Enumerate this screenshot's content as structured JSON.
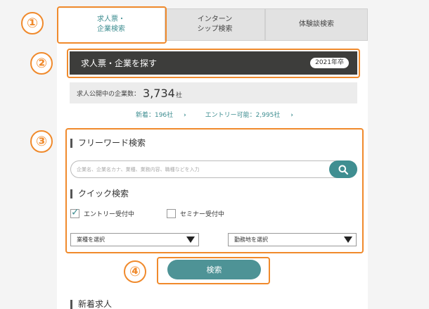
{
  "tabs": [
    {
      "label": "求人票・\n企業検索"
    },
    {
      "label": "インターン\nシップ検索"
    },
    {
      "label": "体験談検索"
    }
  ],
  "markers": [
    "①",
    "②",
    "③",
    "④"
  ],
  "header": {
    "title": "求人票・企業を探す",
    "badge": "2021年卒"
  },
  "count": {
    "label": "求人公開中の企業数：",
    "value": "3,734",
    "unit": "社"
  },
  "links": {
    "new": "新着：196社",
    "entry": "エントリー可能：2,995社"
  },
  "freeword": {
    "heading": "フリーワード検索",
    "placeholder": "企業名、企業名カナ、業種、業務内容、職種などを入力"
  },
  "quick": {
    "heading": "クイック検索",
    "checks": [
      {
        "label": "エントリー受付中",
        "checked": true
      },
      {
        "label": "セミナー受付中",
        "checked": false
      }
    ],
    "selects": [
      {
        "label": "業種を選択"
      },
      {
        "label": "勤務地を選択"
      }
    ]
  },
  "search_label": "検索",
  "new_jobs_heading": "新着求人",
  "colors": {
    "accent": "#3f8e91",
    "highlight": "#f08a2c",
    "dark_bar": "#3d3d3b"
  }
}
